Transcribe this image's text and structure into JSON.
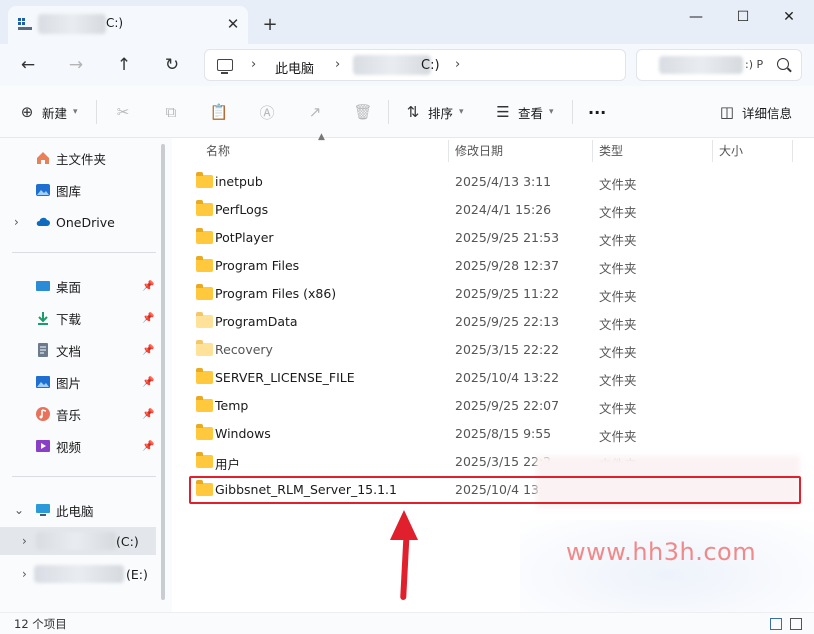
{
  "window": {
    "tab_title": "C:)",
    "new_tab_glyph": "+",
    "close_glyph": "✕",
    "minimize_glyph": "—",
    "maximize_glyph": "☐",
    "close_window_glyph": "✕"
  },
  "address": {
    "crumbs": [
      "此电脑",
      "C:)"
    ],
    "search_text": ":) P"
  },
  "toolbar": {
    "new_label": "新建",
    "sort_label": "排序",
    "view_label": "查看",
    "more_label": "···",
    "details_label": "详细信息"
  },
  "sidebar": {
    "items": [
      {
        "label": "主文件夹",
        "icon": "home-icon"
      },
      {
        "label": "图库",
        "icon": "gallery-icon"
      },
      {
        "label": "OneDrive",
        "icon": "cloud-icon"
      },
      {
        "label": "桌面",
        "icon": "desktop-icon"
      },
      {
        "label": "下载",
        "icon": "download-icon"
      },
      {
        "label": "文档",
        "icon": "document-icon"
      },
      {
        "label": "图片",
        "icon": "pictures-icon"
      },
      {
        "label": "音乐",
        "icon": "music-icon"
      },
      {
        "label": "视频",
        "icon": "video-icon"
      },
      {
        "label": "此电脑",
        "icon": "computer-icon"
      },
      {
        "label": "(C:)",
        "icon": "drive-icon"
      },
      {
        "label": "(E:)",
        "icon": "drive-icon"
      }
    ],
    "accent": "#0067c0"
  },
  "list": {
    "headers": {
      "name": "名称",
      "date": "修改日期",
      "type": "类型",
      "size": "大小"
    },
    "rows": [
      {
        "name": "inetpub",
        "date": "2025/4/13 3:11",
        "type": "文件夹"
      },
      {
        "name": "PerfLogs",
        "date": "2024/4/1 15:26",
        "type": "文件夹"
      },
      {
        "name": "PotPlayer",
        "date": "2025/9/25 21:53",
        "type": "文件夹"
      },
      {
        "name": "Program Files",
        "date": "2025/9/28 12:37",
        "type": "文件夹"
      },
      {
        "name": "Program Files (x86)",
        "date": "2025/9/25 11:22",
        "type": "文件夹"
      },
      {
        "name": "ProgramData",
        "date": "2025/9/25 22:13",
        "type": "文件夹"
      },
      {
        "name": "Recovery",
        "date": "2025/3/15 22:22",
        "type": "文件夹"
      },
      {
        "name": "SERVER_LICENSE_FILE",
        "date": "2025/10/4 13:22",
        "type": "文件夹"
      },
      {
        "name": "Temp",
        "date": "2025/9/25 22:07",
        "type": "文件夹"
      },
      {
        "name": "Windows",
        "date": "2025/8/15 9:55",
        "type": "文件夹"
      },
      {
        "name": "用户",
        "date": "2025/3/15 22:2",
        "type": "文件夹"
      },
      {
        "name": "Gibbsnet_RLM_Server_15.1.1",
        "date": "2025/10/4 13:",
        "type": ""
      }
    ],
    "highlight_color": "#e0202c"
  },
  "watermark": "www.hh3h.com",
  "status": {
    "item_count": "12 个项目"
  }
}
